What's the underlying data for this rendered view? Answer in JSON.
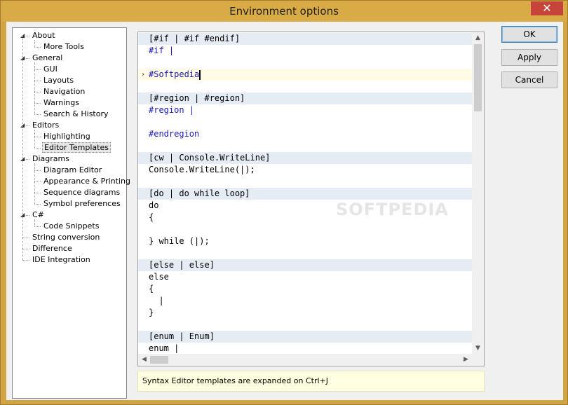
{
  "window": {
    "title": "Environment options",
    "close_symbol": "✕"
  },
  "tree": {
    "nodes": [
      {
        "label": "About",
        "level": 0,
        "expanded": true
      },
      {
        "label": "More Tools",
        "level": 1
      },
      {
        "label": "General",
        "level": 0,
        "expanded": true
      },
      {
        "label": "GUI",
        "level": 1
      },
      {
        "label": "Layouts",
        "level": 1
      },
      {
        "label": "Navigation",
        "level": 1
      },
      {
        "label": "Warnings",
        "level": 1
      },
      {
        "label": "Search & History",
        "level": 1
      },
      {
        "label": "Editors",
        "level": 0,
        "expanded": true
      },
      {
        "label": "Highlighting",
        "level": 1
      },
      {
        "label": "Editor Templates",
        "level": 1,
        "selected": true
      },
      {
        "label": "Diagrams",
        "level": 0,
        "expanded": true
      },
      {
        "label": "Diagram Editor",
        "level": 1
      },
      {
        "label": "Appearance & Printing",
        "level": 1
      },
      {
        "label": "Sequence diagrams",
        "level": 1
      },
      {
        "label": "Symbol preferences",
        "level": 1
      },
      {
        "label": "C#",
        "level": 0,
        "expanded": true
      },
      {
        "label": "Code Snippets",
        "level": 1
      },
      {
        "label": "String conversion",
        "level": 0
      },
      {
        "label": "Difference",
        "level": 0
      },
      {
        "label": "IDE Integration",
        "level": 0
      }
    ]
  },
  "editor": {
    "lines": [
      {
        "text": "[#if | #if #endif]",
        "kind": "hdr"
      },
      {
        "text": "#if |",
        "kind": "kw"
      },
      {
        "text": "",
        "kind": "plain"
      },
      {
        "text": "#Softpedia",
        "kind": "cur"
      },
      {
        "text": "",
        "kind": "plain"
      },
      {
        "text": "[#region | #region]",
        "kind": "hdr"
      },
      {
        "text": "#region |",
        "kind": "kw"
      },
      {
        "text": "",
        "kind": "plain"
      },
      {
        "text": "#endregion",
        "kind": "kw"
      },
      {
        "text": "",
        "kind": "plain"
      },
      {
        "text": "[cw | Console.WriteLine]",
        "kind": "hdr"
      },
      {
        "text": "Console.WriteLine(|);",
        "kind": "plain"
      },
      {
        "text": "",
        "kind": "plain"
      },
      {
        "text": "[do | do while loop]",
        "kind": "hdr"
      },
      {
        "text": "do",
        "kind": "plain"
      },
      {
        "text": "{",
        "kind": "plain"
      },
      {
        "text": "",
        "kind": "plain"
      },
      {
        "text": "} while (|);",
        "kind": "plain"
      },
      {
        "text": "",
        "kind": "plain"
      },
      {
        "text": "[else | else]",
        "kind": "hdr"
      },
      {
        "text": "else",
        "kind": "plain"
      },
      {
        "text": "{",
        "kind": "plain"
      },
      {
        "text": "  |",
        "kind": "plain"
      },
      {
        "text": "}",
        "kind": "plain"
      },
      {
        "text": "",
        "kind": "plain"
      },
      {
        "text": "[enum | Enum]",
        "kind": "hdr"
      },
      {
        "text": "enum |",
        "kind": "plain"
      }
    ],
    "current_line_marker": "›"
  },
  "status": {
    "text": "Syntax Editor templates are expanded on Ctrl+J"
  },
  "buttons": {
    "ok": "OK",
    "apply": "Apply",
    "cancel": "Cancel"
  },
  "icons": {
    "expanded": "◢",
    "scroll_up": "▲",
    "scroll_down": "▼",
    "scroll_left": "◀",
    "scroll_right": "▶"
  },
  "watermark": "SOFTPEDIA",
  "colors": {
    "keyword": "#1a1ab4",
    "header_bg": "#e6ecf3",
    "status_bg": "#ffffe1",
    "titlebar": "#d9ab47"
  }
}
